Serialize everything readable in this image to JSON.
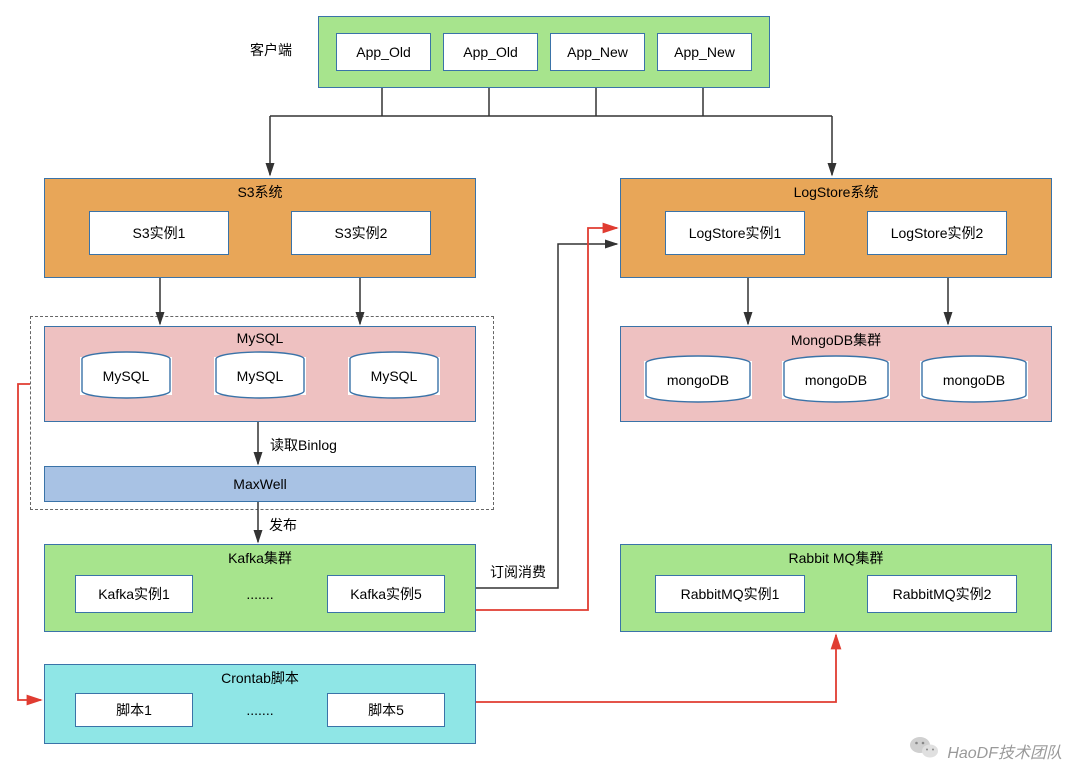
{
  "client": {
    "label": "客户端",
    "apps": [
      "App_Old",
      "App_Old",
      "App_New",
      "App_New"
    ]
  },
  "s3": {
    "title": "S3系统",
    "instances": [
      "S3实例1",
      "S3实例2"
    ]
  },
  "logstore": {
    "title": "LogStore系统",
    "instances": [
      "LogStore实例1",
      "LogStore实例2"
    ]
  },
  "mysql": {
    "title": "MySQL",
    "nodes": [
      "MySQL",
      "MySQL",
      "MySQL"
    ]
  },
  "mongodb": {
    "title": "MongoDB集群",
    "nodes": [
      "mongoDB",
      "mongoDB",
      "mongoDB"
    ]
  },
  "maxwell": {
    "label": "MaxWell"
  },
  "kafka": {
    "title": "Kafka集群",
    "instances": [
      "Kafka实例1",
      ".......",
      "Kafka实例5"
    ]
  },
  "rabbitmq": {
    "title": "Rabbit MQ集群",
    "instances": [
      "RabbitMQ实例1",
      "RabbitMQ实例2"
    ]
  },
  "crontab": {
    "title": "Crontab脚本",
    "scripts": [
      "脚本1",
      ".......",
      "脚本5"
    ]
  },
  "edges": {
    "read_binlog": "读取Binlog",
    "publish": "发布",
    "subscribe": "订阅消费"
  },
  "watermark": "HaoDF技术团队",
  "colors": {
    "green": "#a7e48d",
    "orange": "#e8a658",
    "pink": "#eec1c1",
    "blue": "#a8c2e4",
    "cyan": "#8fe6e6",
    "border": "#3a73a8",
    "arrow_black": "#333333",
    "arrow_red": "#e03c31"
  }
}
